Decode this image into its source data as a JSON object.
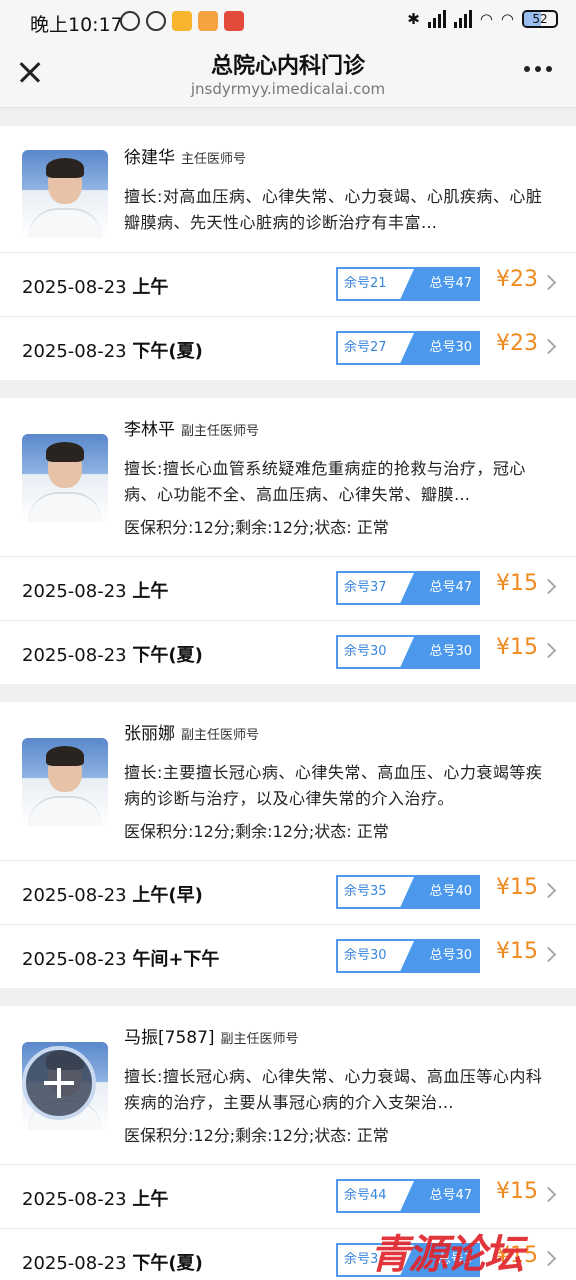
{
  "status_bar": {
    "time": "晚上10:17",
    "battery": "52"
  },
  "header": {
    "title": "总院心内科门诊",
    "url": "jnsdyrmyy.imedicalai.com"
  },
  "doctors": [
    {
      "name": "徐建华",
      "title": "主任医师号",
      "specialty": "擅长:对高血压病、心律失常、心力衰竭、心肌疾病、心脏瓣膜病、先天性心脏病的诊断治疗有丰富…",
      "insurance": "",
      "slots": [
        {
          "date": "2025-08-23",
          "period": "上午",
          "remaining": "余号21",
          "total": "总号47",
          "price": "¥23"
        },
        {
          "date": "2025-08-23",
          "period": "下午(夏)",
          "remaining": "余号27",
          "total": "总号30",
          "price": "¥23"
        }
      ]
    },
    {
      "name": "李林平",
      "title": "副主任医师号",
      "specialty": "擅长:擅长心血管系统疑难危重病症的抢救与治疗，冠心病、心功能不全、高血压病、心律失常、瓣膜…",
      "insurance": "医保积分:12分;剩余:12分;状态:  正常",
      "slots": [
        {
          "date": "2025-08-23",
          "period": "上午",
          "remaining": "余号37",
          "total": "总号47",
          "price": "¥15"
        },
        {
          "date": "2025-08-23",
          "period": "下午(夏)",
          "remaining": "余号30",
          "total": "总号30",
          "price": "¥15"
        }
      ]
    },
    {
      "name": "张丽娜",
      "title": "副主任医师号",
      "specialty": "擅长:主要擅长冠心病、心律失常、高血压、心力衰竭等疾病的诊断与治疗，以及心律失常的介入治疗。",
      "insurance": "医保积分:12分;剩余:12分;状态:  正常",
      "slots": [
        {
          "date": "2025-08-23",
          "period": "上午(早)",
          "remaining": "余号35",
          "total": "总号40",
          "price": "¥15"
        },
        {
          "date": "2025-08-23",
          "period": "午间+下午",
          "remaining": "余号30",
          "total": "总号30",
          "price": "¥15"
        }
      ]
    },
    {
      "name": "马振[7587]",
      "title": "副主任医师号",
      "specialty": "擅长:擅长冠心病、心律失常、心力衰竭、高血压等心内科疾病的治疗，主要从事冠心病的介入支架治…",
      "insurance": "医保积分:12分;剩余:12分;状态:  正常",
      "slots": [
        {
          "date": "2025-08-23",
          "period": "上午",
          "remaining": "余号44",
          "total": "总号47",
          "price": "¥15"
        },
        {
          "date": "2025-08-23",
          "period": "下午(夏)",
          "remaining": "余号3",
          "total": "总号3",
          "price": "¥15"
        }
      ]
    }
  ],
  "watermark": "青源论坛"
}
